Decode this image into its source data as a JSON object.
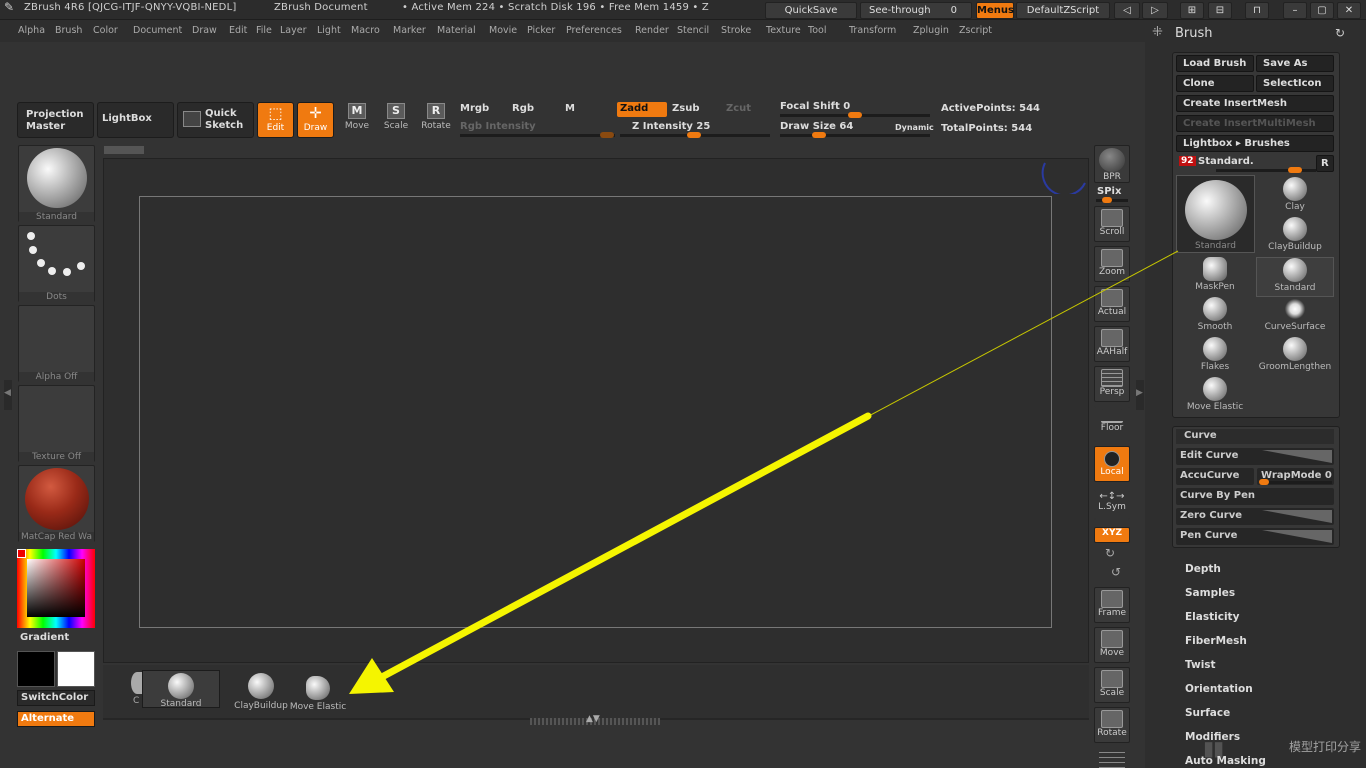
{
  "title": {
    "app": "ZBrush 4R6 [QJCG-ITJF-QNYY-VQBI-NEDL]",
    "doc": "ZBrush Document",
    "mem": "• Active Mem 224 • Scratch Disk 196 • Free Mem 1459 • Z"
  },
  "titlebuttons": {
    "quicksave": "QuickSave",
    "seethrough": "See-through",
    "seethrough_val": "0",
    "menus": "Menus",
    "script": "DefaultZScript"
  },
  "menu": [
    "Alpha",
    "Brush",
    "Color",
    "Document",
    "Draw",
    "Edit",
    "File",
    "Layer",
    "Light",
    "Macro",
    "Marker",
    "Material",
    "Movie",
    "Picker",
    "Preferences",
    "Render",
    "Stencil",
    "Stroke",
    "Texture",
    "Tool",
    "Transform",
    "Zplugin",
    "Zscript"
  ],
  "toolbar": {
    "projection": "Projection Master",
    "lightbox": "LightBox",
    "quicksketch": "Quick Sketch",
    "edit": "Edit",
    "draw": "Draw",
    "move": "Move",
    "scale": "Scale",
    "rotate": "Rotate",
    "move_g": "M",
    "scale_g": "S",
    "rotate_g": "R",
    "mrgb": "Mrgb",
    "rgb": "Rgb",
    "m": "M",
    "rgb_intensity": "Rgb Intensity",
    "zadd": "Zadd",
    "zsub": "Zsub",
    "zcut": "Zcut",
    "z_intensity": "Z Intensity 25",
    "focal_shift": "Focal Shift 0",
    "draw_size": "Draw Size 64",
    "dynamic": "Dynamic",
    "active_points": "ActivePoints: 544",
    "total_points": "TotalPoints: 544"
  },
  "left": {
    "brush": "Standard",
    "stroke": "Dots",
    "alpha": "Alpha Off",
    "texture": "Texture Off",
    "material": "MatCap Red Wa",
    "gradient": "Gradient",
    "switchcolor": "SwitchColor",
    "alternate": "Alternate"
  },
  "tray": {
    "items": [
      "Standard",
      "ClayBuildup",
      "Move Elastic"
    ],
    "partial": "C"
  },
  "right": {
    "bpr": "BPR",
    "spix": "SPix",
    "scroll": "Scroll",
    "zoom": "Zoom",
    "actual": "Actual",
    "aahalf": "AAHalf",
    "persp": "Persp",
    "floor": "Floor",
    "local": "Local",
    "lsym": "L.Sym",
    "xyz": "XYZ",
    "frame": "Frame",
    "move": "Move",
    "scale": "Scale",
    "rotate": "Rotate"
  },
  "palette": {
    "title": "Brush",
    "load": "Load Brush",
    "saveas": "Save As",
    "clone": "Clone",
    "selecticon": "SelectIcon",
    "insertmesh": "Create InsertMesh",
    "insertmulti": "Create InsertMultiMesh",
    "lightbox": "Lightbox ▸ Brushes",
    "badge": "92",
    "current": "Standard.",
    "r": "R",
    "big": "Standard",
    "brushes": [
      "Clay",
      "ClayBuildup",
      "MaskPen",
      "Standard",
      "Smooth",
      "CurveSurface",
      "Flakes",
      "GroomLengthen",
      "Move Elastic"
    ],
    "curve": {
      "title": "Curve",
      "edit": "Edit Curve",
      "accu": "AccuCurve",
      "wrap": "WrapMode 0",
      "bypen": "Curve By Pen",
      "zero": "Zero Curve",
      "pen": "Pen Curve"
    },
    "sections": [
      "Depth",
      "Samples",
      "Elasticity",
      "FiberMesh",
      "Twist",
      "Orientation",
      "Surface",
      "Modifiers",
      "Auto Masking"
    ]
  },
  "watermark": "模型打印分享",
  "colors": {
    "accent": "#f07a10",
    "arrow": "#f5f500"
  }
}
